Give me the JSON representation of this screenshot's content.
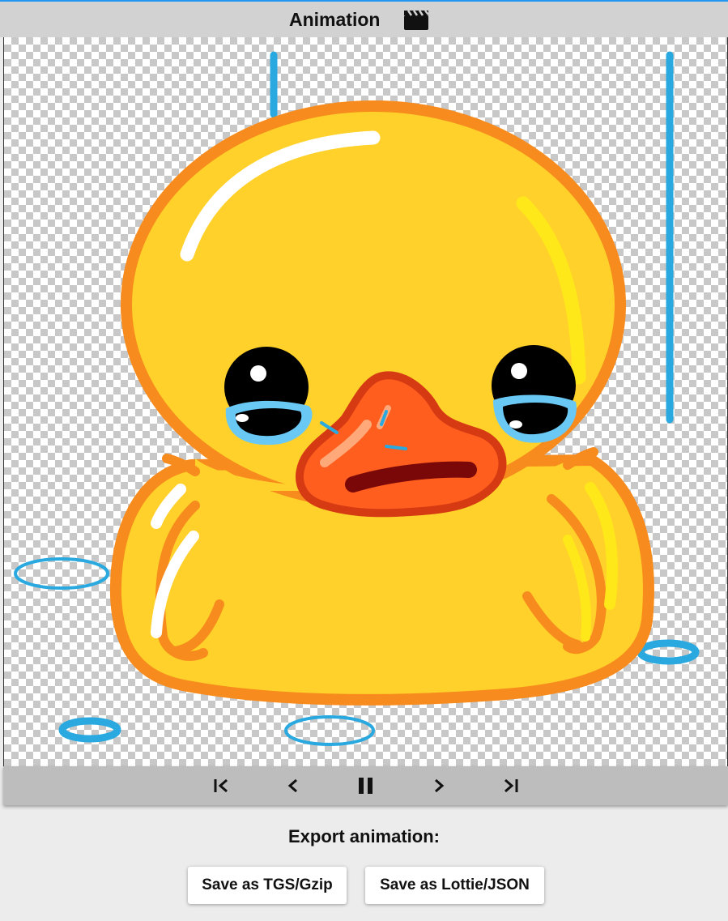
{
  "header": {
    "title": "Animation",
    "icon": "clapperboard-icon"
  },
  "controls": {
    "first_icon": "skip-to-start-icon",
    "prev_icon": "step-back-icon",
    "pause_icon": "pause-icon",
    "next_icon": "step-forward-icon",
    "last_icon": "skip-to-end-icon"
  },
  "export": {
    "label": "Export animation:",
    "tgs_button": "Save as TGS/Gzip",
    "lottie_button": "Save as Lottie/JSON"
  },
  "colors": {
    "header_bg": "#d2d2d2",
    "duck_body": "#ffd12a",
    "duck_outline": "#f78b1d",
    "beak": "#ff5e1e",
    "tears": "#6ac8f5",
    "water": "#29a9df"
  }
}
